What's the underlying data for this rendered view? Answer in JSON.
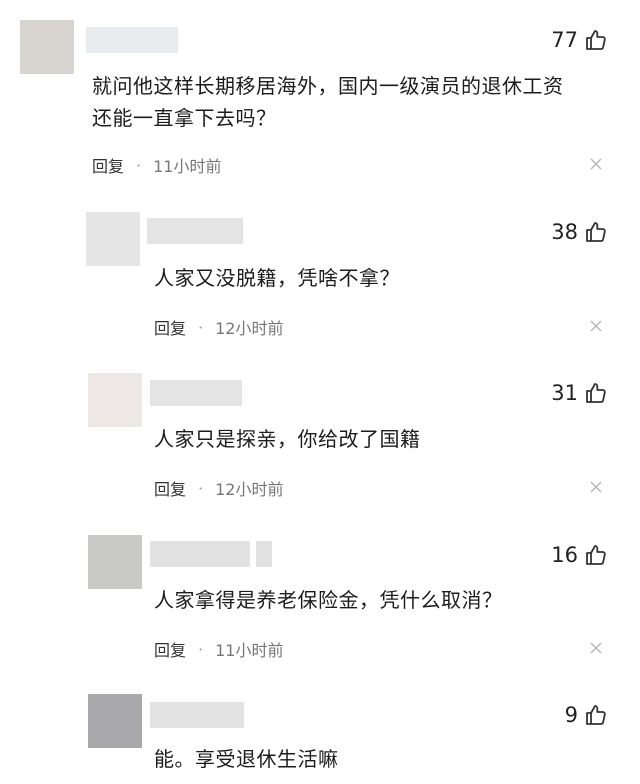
{
  "comments": [
    {
      "likes": "77",
      "text_line1": "就问他这样长期移居海外，国内一级演员的退休工资",
      "text_line2": "还能一直拿下去吗？",
      "reply_label": "回复",
      "dot": "·",
      "time": "11小时前",
      "close": "×"
    },
    {
      "likes": "38",
      "text_line1": "人家又没脱籍，凭啥不拿？",
      "reply_label": "回复",
      "dot": "·",
      "time": "12小时前",
      "close": "×"
    },
    {
      "likes": "31",
      "text_line1": "人家只是探亲，你给改了国籍",
      "reply_label": "回复",
      "dot": "·",
      "time": "12小时前",
      "close": "×"
    },
    {
      "likes": "16",
      "text_line1": "人家拿得是养老保险金，凭什么取消？",
      "reply_label": "回复",
      "dot": "·",
      "time": "11小时前",
      "close": "×"
    },
    {
      "likes": "9",
      "text_line1": "能。享受退休生活嘛"
    }
  ],
  "icons": {
    "like": "thumbs-up-icon",
    "close": "close-icon"
  }
}
